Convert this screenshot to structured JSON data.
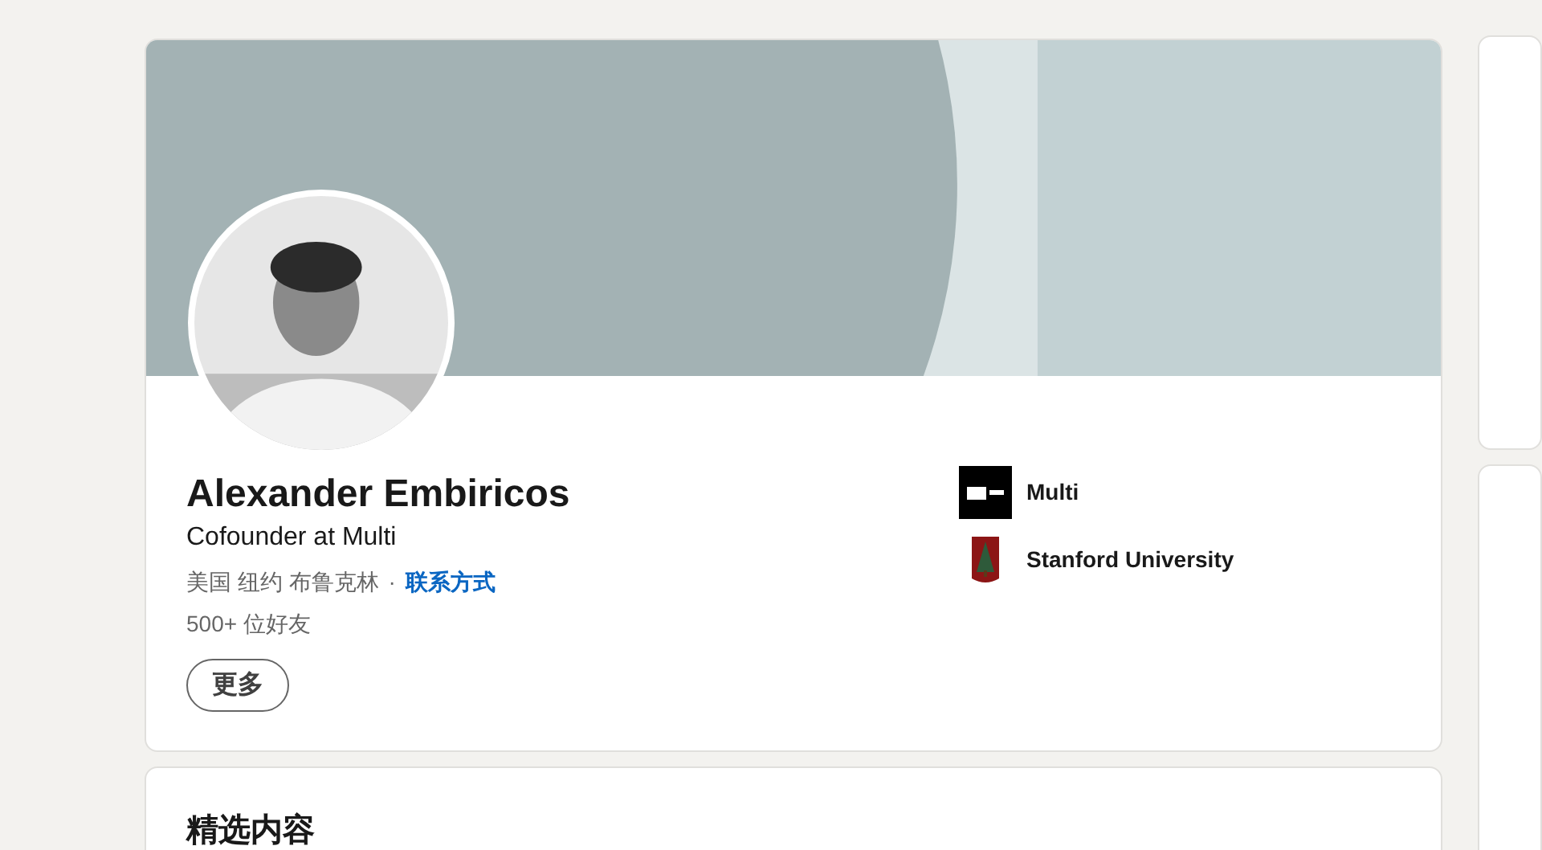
{
  "profile": {
    "name": "Alexander Embiricos",
    "headline": "Cofounder at Multi",
    "location": "美国 纽约 布鲁克林",
    "separator": "·",
    "contact_link": "联系方式",
    "connections": "500+ 位好友",
    "more_button": "更多",
    "affiliations": [
      {
        "kind": "square",
        "label": "Multi"
      },
      {
        "kind": "shield",
        "label": "Stanford University"
      }
    ]
  },
  "featured": {
    "title": "精选内容"
  }
}
